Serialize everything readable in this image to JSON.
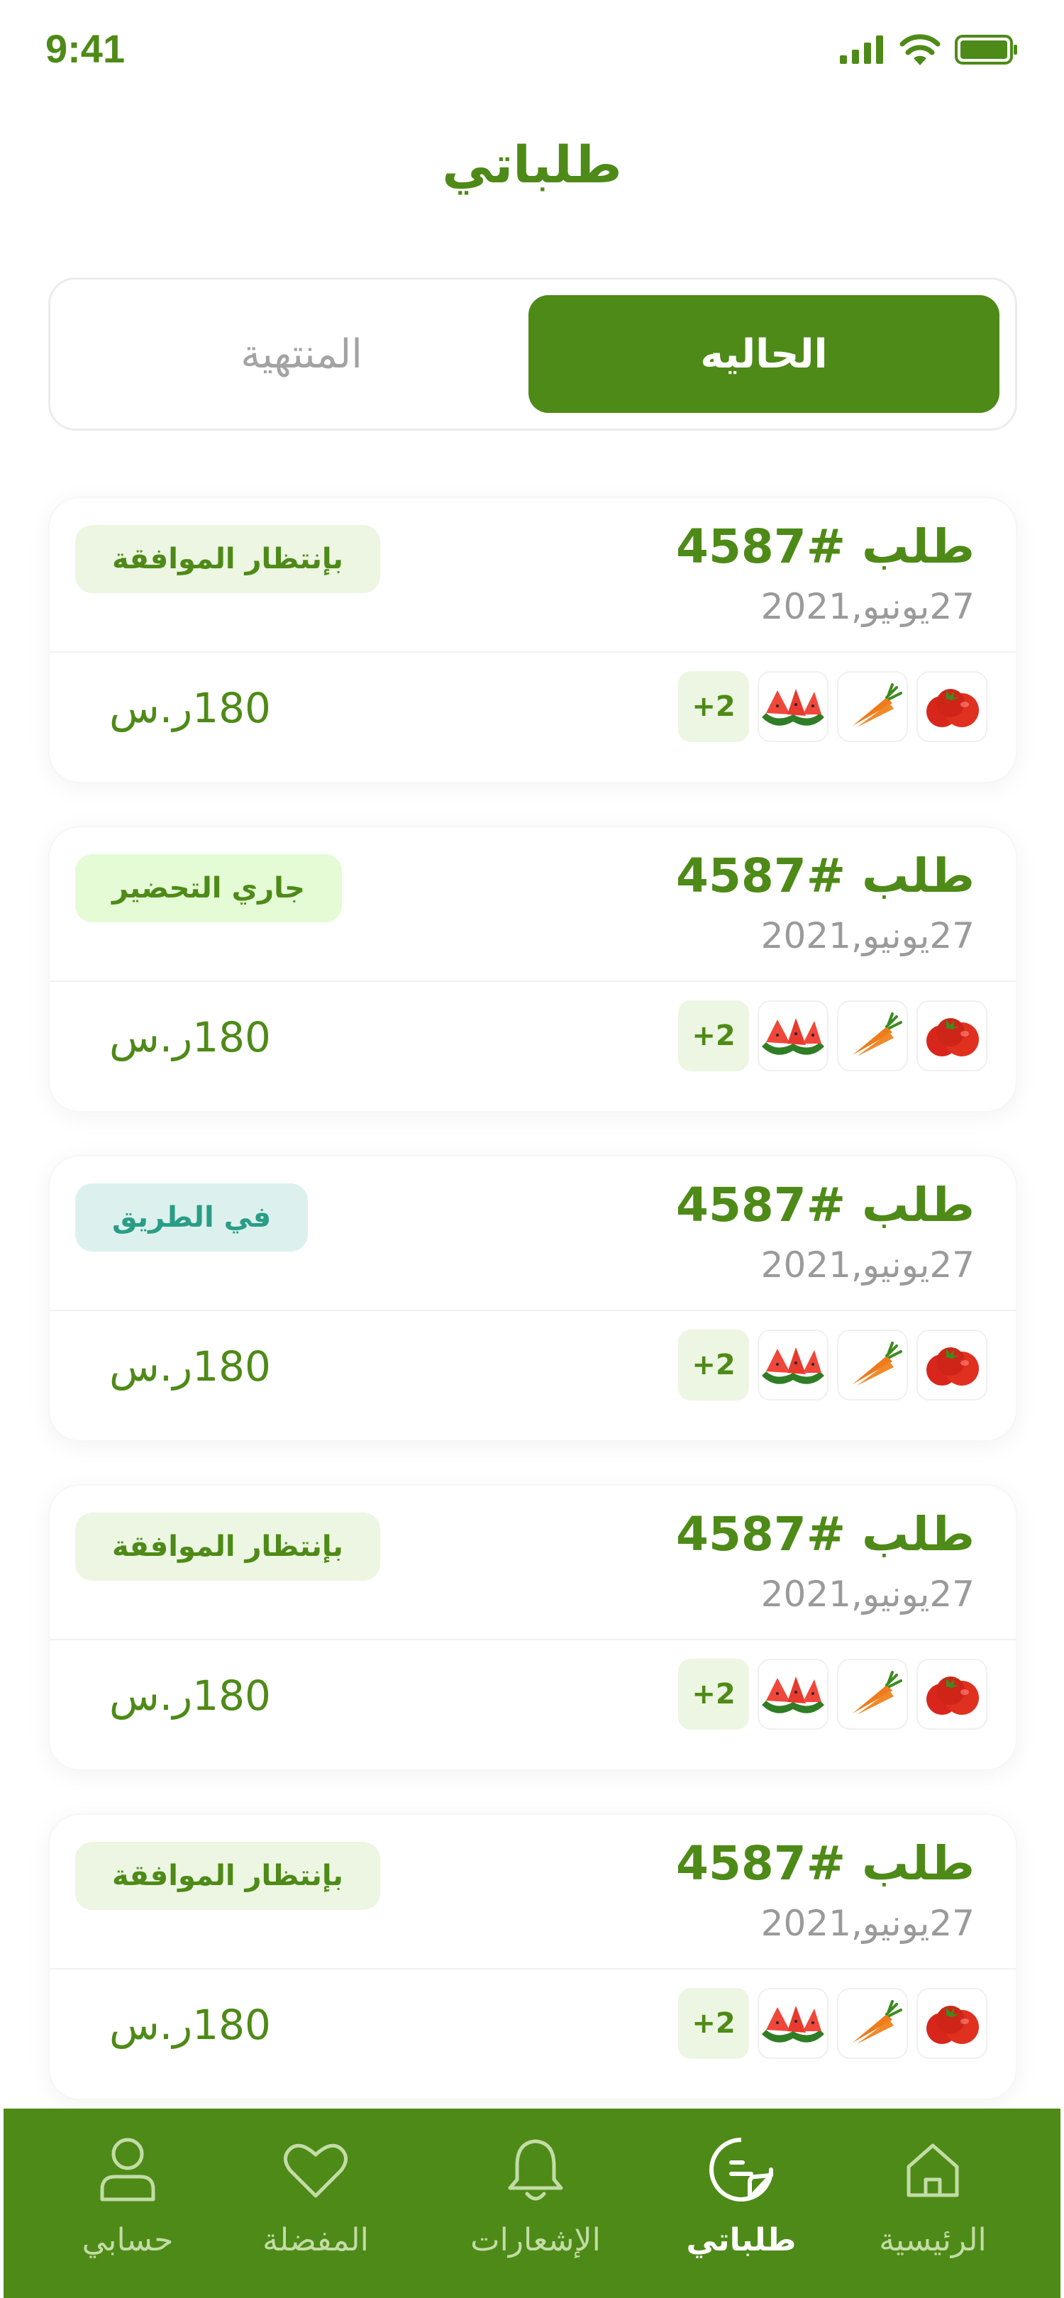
{
  "status_bar": {
    "time": "9:41"
  },
  "page_title": "طلباتي",
  "tabs": {
    "current": "الحاليه",
    "finished": "المنتهية"
  },
  "orders": [
    {
      "title": "طلب #4587",
      "date": "27يونيو,2021",
      "status": "بإنتظار الموافقة",
      "status_type": "waiting",
      "price": "180ر.س",
      "extra_items": "+2"
    },
    {
      "title": "طلب #4587",
      "date": "27يونيو,2021",
      "status": "جاري التحضير",
      "status_type": "preparing",
      "price": "180ر.س",
      "extra_items": "+2"
    },
    {
      "title": "طلب #4587",
      "date": "27يونيو,2021",
      "status": "في الطريق",
      "status_type": "on-the-way",
      "price": "180ر.س",
      "extra_items": "+2"
    },
    {
      "title": "طلب #4587",
      "date": "27يونيو,2021",
      "status": "بإنتظار الموافقة",
      "status_type": "waiting",
      "price": "180ر.س",
      "extra_items": "+2"
    },
    {
      "title": "طلب #4587",
      "date": "27يونيو,2021",
      "status": "بإنتظار الموافقة",
      "status_type": "waiting",
      "price": "180ر.س",
      "extra_items": "+2"
    }
  ],
  "bottom_nav": {
    "home": "الرئيسية",
    "orders": "طلباتي",
    "notifications": "الإشعارات",
    "favorites": "المفضلة",
    "account": "حسابي"
  },
  "colors": {
    "primary": "#4e8a17",
    "muted": "#9a9a9a",
    "nav_inactive": "#c3dca6"
  },
  "icons": [
    "signal-icon",
    "wifi-icon",
    "battery-icon",
    "home-icon",
    "orders-icon",
    "bell-icon",
    "heart-icon",
    "user-icon",
    "tomato-icon",
    "carrot-icon",
    "watermelon-icon"
  ]
}
